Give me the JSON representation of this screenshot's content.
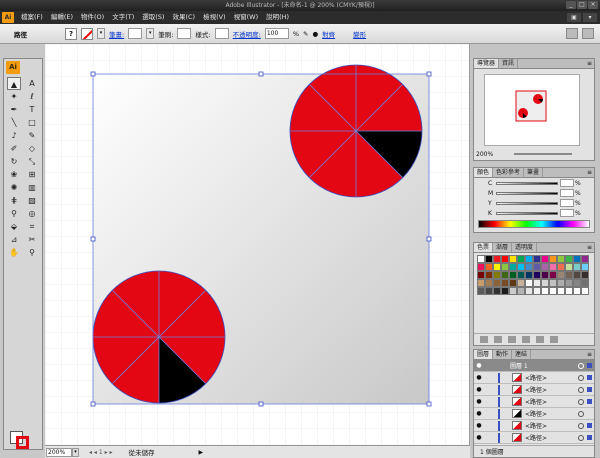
{
  "app": {
    "title": "Adobe Illustrator - [未命名-1 @ 200% (CMYK/預視)]",
    "logo": "Ai",
    "window_buttons": [
      "_",
      "□",
      "×"
    ]
  },
  "menu": {
    "items": [
      "檔案(F)",
      "編輯(E)",
      "物件(O)",
      "文字(T)",
      "選取(S)",
      "效果(C)",
      "檢視(V)",
      "視窗(W)",
      "說明(H)"
    ]
  },
  "control": {
    "selection_label": "路徑",
    "stroke_label": "筆畫:",
    "brush_label": "筆刷:",
    "style_label": "樣式:",
    "opacity_label": "不透明度:",
    "opacity_value": "100",
    "opacity_unit": "%",
    "recolor_label": "對齊",
    "transform_label": "變形",
    "question_mark": "?"
  },
  "tools": [
    {
      "name": "selection-tool",
      "glyph": "▲"
    },
    {
      "name": "direct-selection-tool",
      "glyph": "A"
    },
    {
      "name": "magic-wand-tool",
      "glyph": "✦"
    },
    {
      "name": "lasso-tool",
      "glyph": "ℓ"
    },
    {
      "name": "pen-tool",
      "glyph": "✒"
    },
    {
      "name": "type-tool",
      "glyph": "T"
    },
    {
      "name": "line-tool",
      "glyph": "╲"
    },
    {
      "name": "rectangle-tool",
      "glyph": "□"
    },
    {
      "name": "paintbrush-tool",
      "glyph": "♪"
    },
    {
      "name": "pencil-tool",
      "glyph": "✎"
    },
    {
      "name": "blob-brush-tool",
      "glyph": "✐"
    },
    {
      "name": "eraser-tool",
      "glyph": "◇"
    },
    {
      "name": "rotate-tool",
      "glyph": "↻"
    },
    {
      "name": "scale-tool",
      "glyph": "⤡"
    },
    {
      "name": "warp-tool",
      "glyph": "❀"
    },
    {
      "name": "free-transform-tool",
      "glyph": "⊞"
    },
    {
      "name": "symbol-sprayer-tool",
      "glyph": "✺"
    },
    {
      "name": "column-graph-tool",
      "glyph": "▥"
    },
    {
      "name": "mesh-tool",
      "glyph": "⋕"
    },
    {
      "name": "gradient-tool",
      "glyph": "▨"
    },
    {
      "name": "eyedropper-tool",
      "glyph": "⚲"
    },
    {
      "name": "blend-tool",
      "glyph": "◎"
    },
    {
      "name": "live-paint-tool",
      "glyph": "⬙"
    },
    {
      "name": "crop-area-tool",
      "glyph": "⌗"
    },
    {
      "name": "slice-tool",
      "glyph": "⊿"
    },
    {
      "name": "scissors-tool",
      "glyph": "✂"
    },
    {
      "name": "hand-tool",
      "glyph": "✋"
    },
    {
      "name": "zoom-tool",
      "glyph": "⚲"
    }
  ],
  "status": {
    "zoom": "200%",
    "nav": "◂ ◂ 1 ▸ ▸",
    "text": "從未儲存"
  },
  "navigator": {
    "tabs": [
      "導覽器",
      "資訊"
    ],
    "zoom": "200%"
  },
  "color": {
    "tabs": [
      "顏色",
      "色彩參考",
      "筆畫"
    ],
    "channels": [
      "C",
      "M",
      "Y",
      "K"
    ],
    "percent": "%"
  },
  "swatches": {
    "tabs": [
      "色票",
      "漸層",
      "透明度"
    ],
    "colors": [
      "#ffffff",
      "#000000",
      "#ed1c24",
      "#ff0000",
      "#ffde00",
      "#00a651",
      "#00aeef",
      "#2e3192",
      "#ec008c",
      "#f7941d",
      "#8dc63f",
      "#39b54a",
      "#0072bc",
      "#92278f",
      "#ed145b",
      "#f26522",
      "#fff200",
      "#8dc63f",
      "#00a99d",
      "#00bff3",
      "#448ccb",
      "#605ca8",
      "#a864a8",
      "#f06eaa",
      "#f26c4f",
      "#c4df9b",
      "#7accc8",
      "#6dcff6",
      "#790000",
      "#7b2e00",
      "#827b00",
      "#406618",
      "#005e20",
      "#005952",
      "#003663",
      "#21005d",
      "#4b0049",
      "#7b0046",
      "#998675",
      "#736357",
      "#534741",
      "#362f2d",
      "#c69c6d",
      "#a67c52",
      "#8c6239",
      "#754c24",
      "#603913",
      "#c7b299",
      "#fbfbfb",
      "#ebebeb",
      "#d7d7d7",
      "#c2c2c2",
      "#adadad",
      "#999999",
      "#858585",
      "#707070",
      "#5c5c5c",
      "#474747",
      "#333333",
      "#1c1c1c",
      "#cccccc",
      "#b3b3b3",
      "#e6e6e6",
      "#f2f2f2",
      "#ffffff",
      "#ffffff",
      "#ffffff",
      "#ffffff",
      "#ffffff",
      "#ffffff"
    ]
  },
  "layers": {
    "tabs": [
      "圖層",
      "動作",
      "連結"
    ],
    "top_row": "圖層 1",
    "items": [
      "<路徑>",
      "<路徑>",
      "<路徑>",
      "<路徑>",
      "<路徑>",
      "<路徑>"
    ],
    "footer": "1 個圖層"
  },
  "accent": {
    "selection_blue": "#3a4fc0",
    "pie_red": "#e30613",
    "ai_orange": "#f39c12"
  }
}
